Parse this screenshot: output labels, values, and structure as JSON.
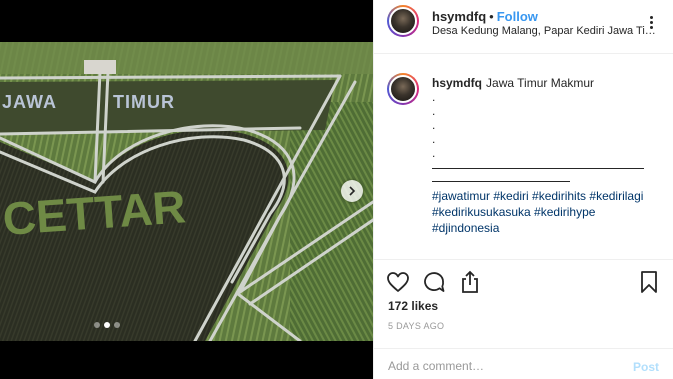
{
  "media": {
    "photo_text": {
      "line1_left": "JAWA",
      "line1_right": "TIMUR",
      "heart": "CETTAR"
    },
    "carousel": {
      "count": 3,
      "active": 1
    }
  },
  "header": {
    "username": "hsymdfq",
    "separator": "•",
    "follow_label": "Follow",
    "location": "Desa Kedung Malang, Papar Kediri Jawa Timur"
  },
  "caption": {
    "username": "hsymdfq",
    "text": "Jawa Timur Makmur",
    "dot_lines": [
      ".",
      ".",
      ".",
      ".",
      "."
    ],
    "hashtags": "#jawatimur #kediri #kedirihits #kedirilagi #kedirikusukasuka #kedirihype #djindonesia"
  },
  "stats": {
    "likes": "172 likes",
    "time_ago": "5 DAYS AGO"
  },
  "comment_box": {
    "placeholder": "Add a comment…",
    "post_label": "Post"
  },
  "icons": {
    "like": "heart-icon",
    "comment": "speech-bubble-icon",
    "share": "share-icon",
    "save": "bookmark-icon",
    "more": "more-options-icon",
    "next": "chevron-right-icon"
  },
  "colors": {
    "follow": "#3897f0",
    "hashtag": "#003569",
    "post_disabled": "#b2dffc"
  }
}
